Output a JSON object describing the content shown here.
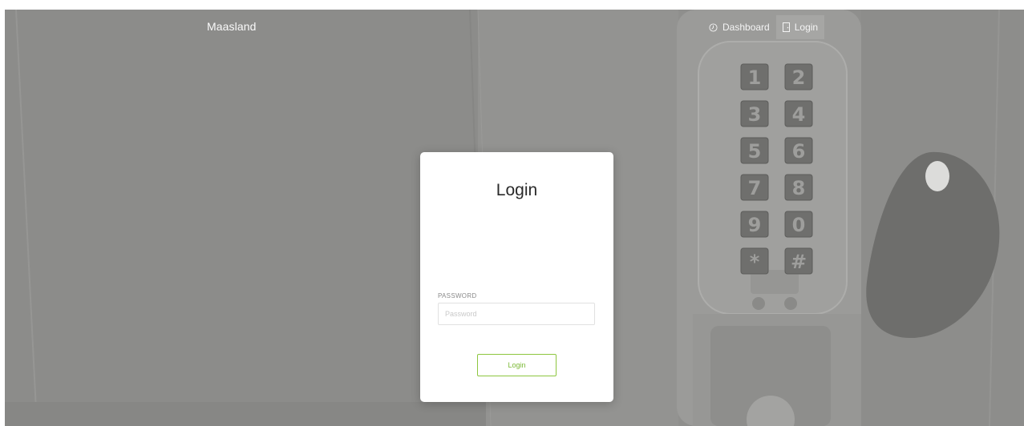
{
  "app": {
    "brand": "Maasland"
  },
  "nav": {
    "dashboard_label": "Dashboard",
    "login_label": "Login",
    "dashboard_icon": "clock-icon",
    "login_icon": "door-icon"
  },
  "login_card": {
    "title": "Login",
    "password_label": "PASSWORD",
    "password_placeholder": "Password",
    "password_value": "",
    "submit_label": "Login"
  },
  "keypad": {
    "keys": [
      "1",
      "2",
      "3",
      "4",
      "5",
      "6",
      "7",
      "8",
      "9",
      "0",
      "*",
      "#"
    ]
  },
  "colors": {
    "accent": "#8dc63f",
    "overlay": "#8f8f8d",
    "card": "#ffffff"
  }
}
